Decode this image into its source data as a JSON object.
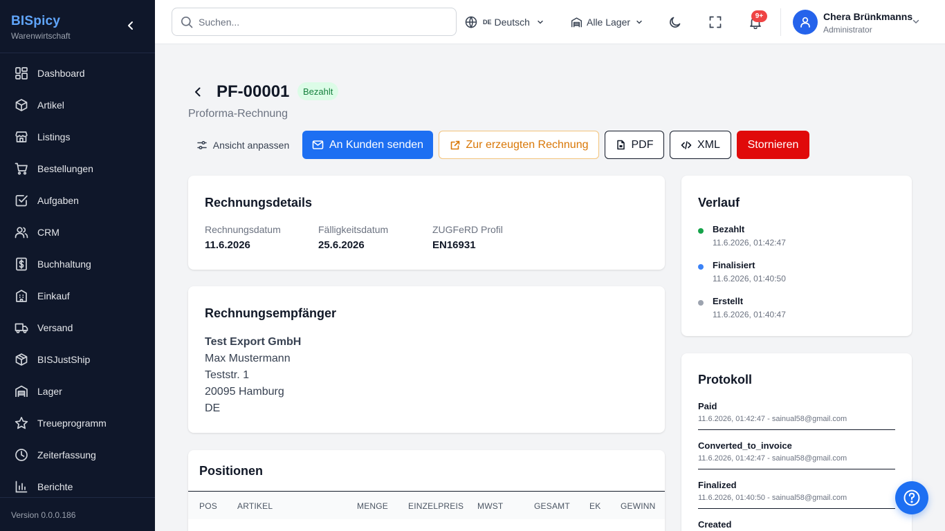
{
  "app": {
    "brand": "BISpicy",
    "brand_sub": "Warenwirtschaft",
    "version": "Version 0.0.0.186"
  },
  "sidebar": {
    "items": [
      {
        "label": "Dashboard",
        "icon": "dashboard-icon"
      },
      {
        "label": "Artikel",
        "icon": "box-icon"
      },
      {
        "label": "Listings",
        "icon": "store-icon"
      },
      {
        "label": "Bestellungen",
        "icon": "cart-icon"
      },
      {
        "label": "Aufgaben",
        "icon": "checkbox-icon"
      },
      {
        "label": "CRM",
        "icon": "users-icon"
      },
      {
        "label": "Buchhaltung",
        "icon": "dollar-icon"
      },
      {
        "label": "Einkauf",
        "icon": "building-icon"
      },
      {
        "label": "Versand",
        "icon": "truck-icon"
      },
      {
        "label": "BISJustShip",
        "icon": "package-icon"
      },
      {
        "label": "Lager",
        "icon": "warehouse-icon"
      },
      {
        "label": "Treueprogramm",
        "icon": "star-icon"
      },
      {
        "label": "Zeiterfassung",
        "icon": "clock-icon"
      },
      {
        "label": "Berichte",
        "icon": "chart-icon"
      }
    ]
  },
  "topbar": {
    "search_placeholder": "Suchen...",
    "language_code": "DE",
    "language": "Deutsch",
    "warehouse": "Alle Lager",
    "notifications": "9+",
    "user_name": "Chera Brünkmanns",
    "user_role": "Administrator"
  },
  "doc": {
    "number": "PF-00001",
    "status": "Bezahlt",
    "type": "Proforma-Rechnung",
    "status_color": "#15803d"
  },
  "actions": {
    "view": "Ansicht anpassen",
    "send": "An Kunden senden",
    "goto": "Zur erzeugten Rechnung",
    "pdf": "PDF",
    "xml": "XML",
    "cancel": "Stornieren"
  },
  "details": {
    "title": "Rechnungsdetails",
    "invoice_date_label": "Rechnungsdatum",
    "invoice_date": "11.6.2026",
    "due_date_label": "Fälligkeitsdatum",
    "due_date": "25.6.2026",
    "profile_label": "ZUGFeRD Profil",
    "profile": "EN16931"
  },
  "recipient": {
    "title": "Rechnungsempfänger",
    "company": "Test Export GmbH",
    "lines": [
      "Max Mustermann",
      "Teststr. 1",
      "20095 Hamburg",
      "DE"
    ]
  },
  "positions": {
    "title": "Positionen",
    "columns": [
      "POS",
      "ARTIKEL",
      "MENGE",
      "EINZELPREIS",
      "MWST",
      "GESAMT",
      "EK",
      "GEWINN"
    ]
  },
  "history": {
    "title": "Verlauf",
    "entries": [
      {
        "status": "Bezahlt",
        "time": "11.6.2026, 01:42:47",
        "color": "#16a34a"
      },
      {
        "status": "Finalisiert",
        "time": "11.6.2026, 01:40:50",
        "color": "#3b82f6"
      },
      {
        "status": "Erstellt",
        "time": "11.6.2026, 01:40:47",
        "color": "#9ca3af"
      }
    ]
  },
  "log": {
    "title": "Protokoll",
    "entries": [
      {
        "action": "Paid",
        "meta": "11.6.2026, 01:42:47 - sainual58@gmail.com"
      },
      {
        "action": "Converted_to_invoice",
        "meta": "11.6.2026, 01:42:47 - sainual58@gmail.com"
      },
      {
        "action": "Finalized",
        "meta": "11.6.2026, 01:40:50 - sainual58@gmail.com"
      },
      {
        "action": "Created",
        "meta": ""
      }
    ]
  },
  "colors": {
    "primary": "#1d6ff2",
    "danger": "#e00a0a",
    "sidebar": "#0f172a",
    "warning": "#d97706"
  }
}
